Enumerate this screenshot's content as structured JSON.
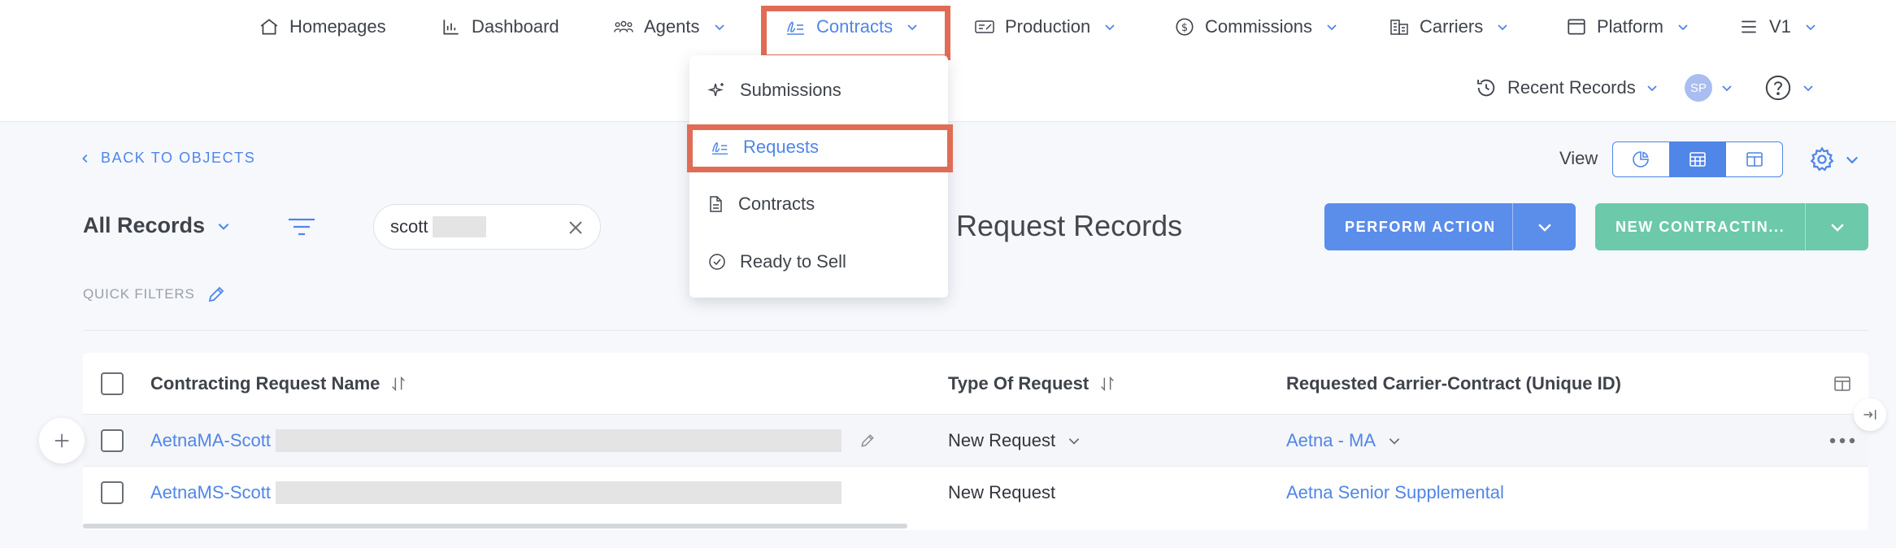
{
  "nav": {
    "items": [
      {
        "label": "Homepages",
        "icon": "home-icon"
      },
      {
        "label": "Dashboard",
        "icon": "bar-chart-icon"
      },
      {
        "label": "Agents",
        "icon": "agents-icon"
      },
      {
        "label": "Contracts",
        "icon": "signature-icon",
        "active": true
      },
      {
        "label": "Production",
        "icon": "production-icon"
      },
      {
        "label": "Commissions",
        "icon": "dollar-circle-icon"
      },
      {
        "label": "Carriers",
        "icon": "building-icon"
      },
      {
        "label": "Platform",
        "icon": "window-icon"
      },
      {
        "label": "V1",
        "icon": "menu-icon"
      }
    ],
    "recent_records": "Recent Records",
    "avatar_initials": "SP"
  },
  "dropdown": {
    "items": [
      {
        "label": "Submissions",
        "icon": "sparkle-icon"
      },
      {
        "label": "Requests",
        "icon": "signature-icon",
        "active": true
      },
      {
        "label": "Contracts",
        "icon": "document-icon"
      },
      {
        "label": "Ready to Sell",
        "icon": "check-circle-icon"
      }
    ]
  },
  "page": {
    "back_link": "BACK TO OBJECTS",
    "view_label": "View",
    "record_filter": "All Records",
    "search_value": "scott",
    "title": "Request Records",
    "perform_action": "PERFORM ACTION",
    "new_contracting": "NEW CONTRACTIN...",
    "quick_filters": "QUICK FILTERS"
  },
  "table": {
    "columns": [
      "Contracting Request Name",
      "Type Of Request",
      "Requested Carrier-Contract (Unique ID)"
    ],
    "rows": [
      {
        "name": "AetnaMA-Scott",
        "type": "New Request",
        "carrier": "Aetna - MA"
      },
      {
        "name": "AetnaMS-Scott",
        "type": "New Request",
        "carrier": "Aetna Senior Supplemental"
      }
    ]
  },
  "colors": {
    "accent": "#4f86e8",
    "highlight": "#e06c55",
    "perform_button": "#5b8dea",
    "new_button": "#6cc9a9"
  }
}
